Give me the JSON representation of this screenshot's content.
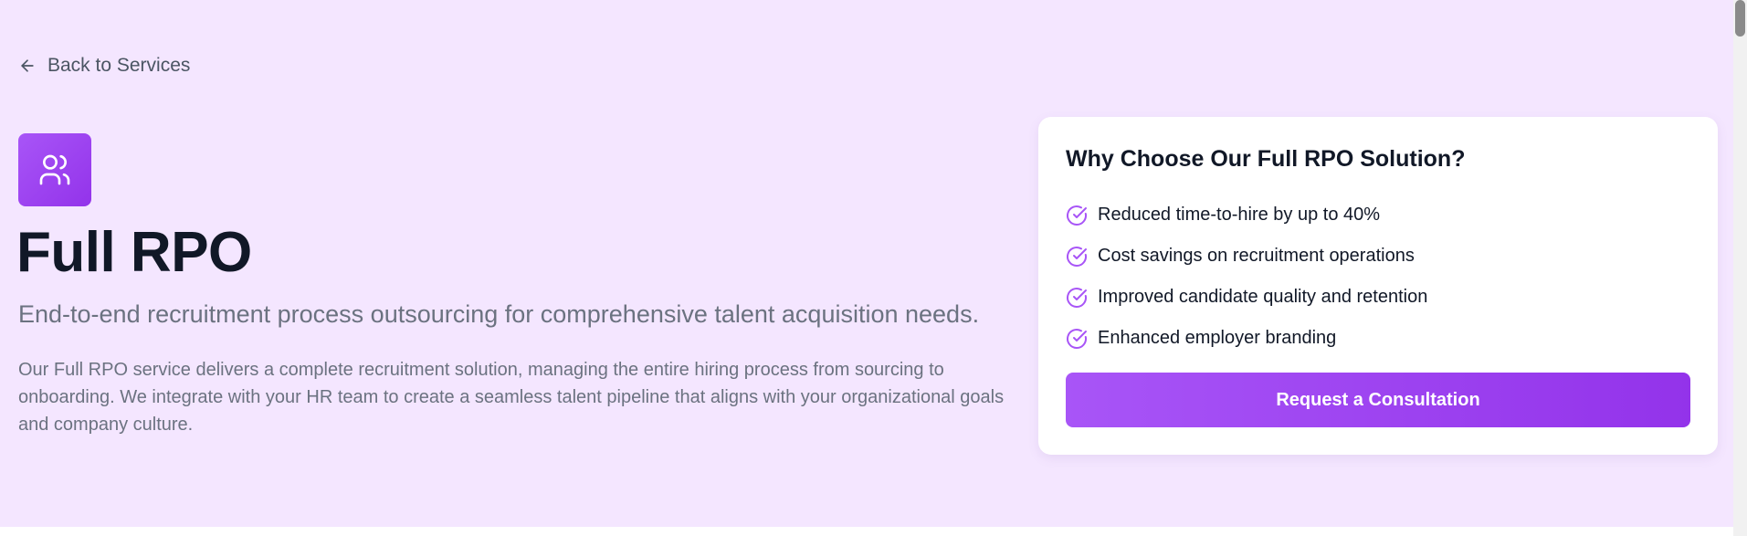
{
  "navigation": {
    "back_label": "Back to Services",
    "back_icon": "arrow-left-icon"
  },
  "service": {
    "icon": "users-icon",
    "title": "Full RPO",
    "subtitle": "End-to-end recruitment process outsourcing for comprehensive talent acquisition needs.",
    "description": "Our Full RPO service delivers a complete recruitment solution, managing the entire hiring process from sourcing to onboarding. We integrate with your HR team to create a seamless talent pipeline that aligns with your organizational goals and company culture."
  },
  "card": {
    "title": "Why Choose Our Full RPO Solution?",
    "benefits": [
      "Reduced time-to-hire by up to 40%",
      "Cost savings on recruitment operations",
      "Improved candidate quality and retention",
      "Enhanced employer branding"
    ],
    "benefit_icon": "check-circle-icon",
    "cta_label": "Request a Consultation"
  },
  "colors": {
    "hero_background": "#f4e6ff",
    "accent": "#a855f7",
    "accent_dark": "#9333ea",
    "heading": "#111827",
    "muted_text": "#6b7280"
  }
}
